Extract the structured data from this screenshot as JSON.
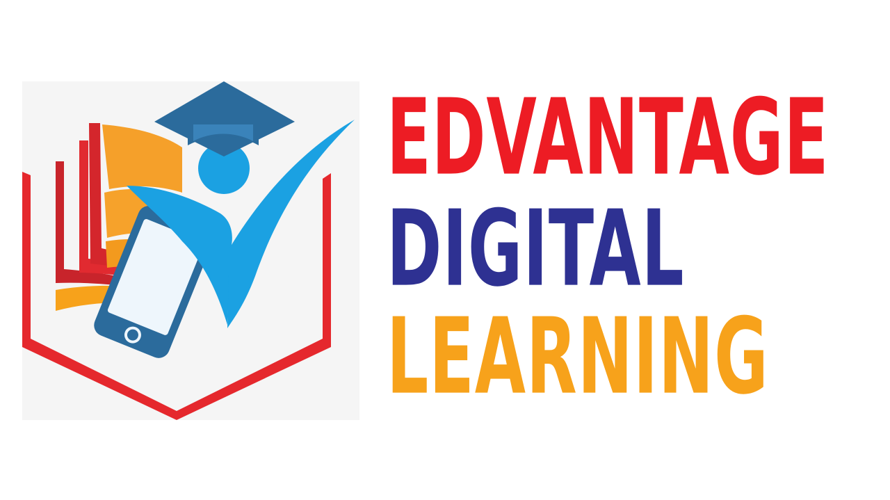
{
  "logo": {
    "wordmark": {
      "line1": "EDVANTAGE",
      "line2": "DIGITAL",
      "line3": "LEARNING"
    },
    "emblem": {
      "icons": [
        "graduation-cap-icon",
        "student-figure-icon",
        "smartphone-icon",
        "open-book-icon",
        "hexagon-frame-icon",
        "checkmark-icon"
      ]
    },
    "colors": {
      "red": "#ed1c24",
      "navy": "#2e3192",
      "orange": "#f7a21b",
      "sky_blue": "#1ba1e2",
      "steel_blue": "#2b6b9c",
      "panel_gray": "#f5f5f5"
    }
  }
}
